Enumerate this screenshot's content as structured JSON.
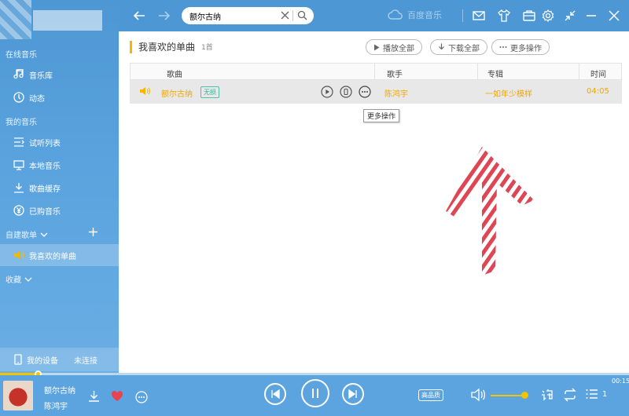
{
  "sidebar": {
    "online_section": "在线音乐",
    "online_items": [
      {
        "label": "音乐库",
        "icon": "music-note-icon"
      },
      {
        "label": "动态",
        "icon": "compass-icon"
      }
    ],
    "my_section": "我的音乐",
    "my_items": [
      {
        "label": "试听列表",
        "icon": "list-icon"
      },
      {
        "label": "本地音乐",
        "icon": "monitor-icon"
      },
      {
        "label": "歌曲缓存",
        "icon": "download-icon"
      },
      {
        "label": "已购音乐",
        "icon": "yen-icon"
      }
    ],
    "custom_section": "自建歌单",
    "playlists": [
      {
        "label": "我喜欢的单曲",
        "icon": "speaker-icon",
        "active": true
      }
    ],
    "collect_section": "收藏",
    "device_label": "我的设备",
    "device_status": "未连接"
  },
  "topbar": {
    "search_value": "额尔古纳",
    "brand": "百度音乐"
  },
  "playlist": {
    "title": "我喜欢的单曲",
    "count": "1首",
    "play_all": "播放全部",
    "download_all": "下载全部",
    "more_ops": "更多操作"
  },
  "table": {
    "headers": [
      "歌曲",
      "歌手",
      "专辑",
      "时间"
    ],
    "rows": [
      {
        "title": "额尔古纳",
        "badge": "无损",
        "artist": "陈鸿宇",
        "album": "一如年少模样",
        "duration": "04:05"
      }
    ]
  },
  "tooltip": "更多操作",
  "player": {
    "title": "额尔古纳",
    "artist": "陈鸿宇",
    "quality": "高品质",
    "time": "00:15",
    "queue_count": "1",
    "progress_fraction": 0.06,
    "volume_fraction": 0.9
  },
  "colors": {
    "accent": "#f5b800",
    "sidebar": "#4d97d4",
    "player": "#5ca4df"
  }
}
